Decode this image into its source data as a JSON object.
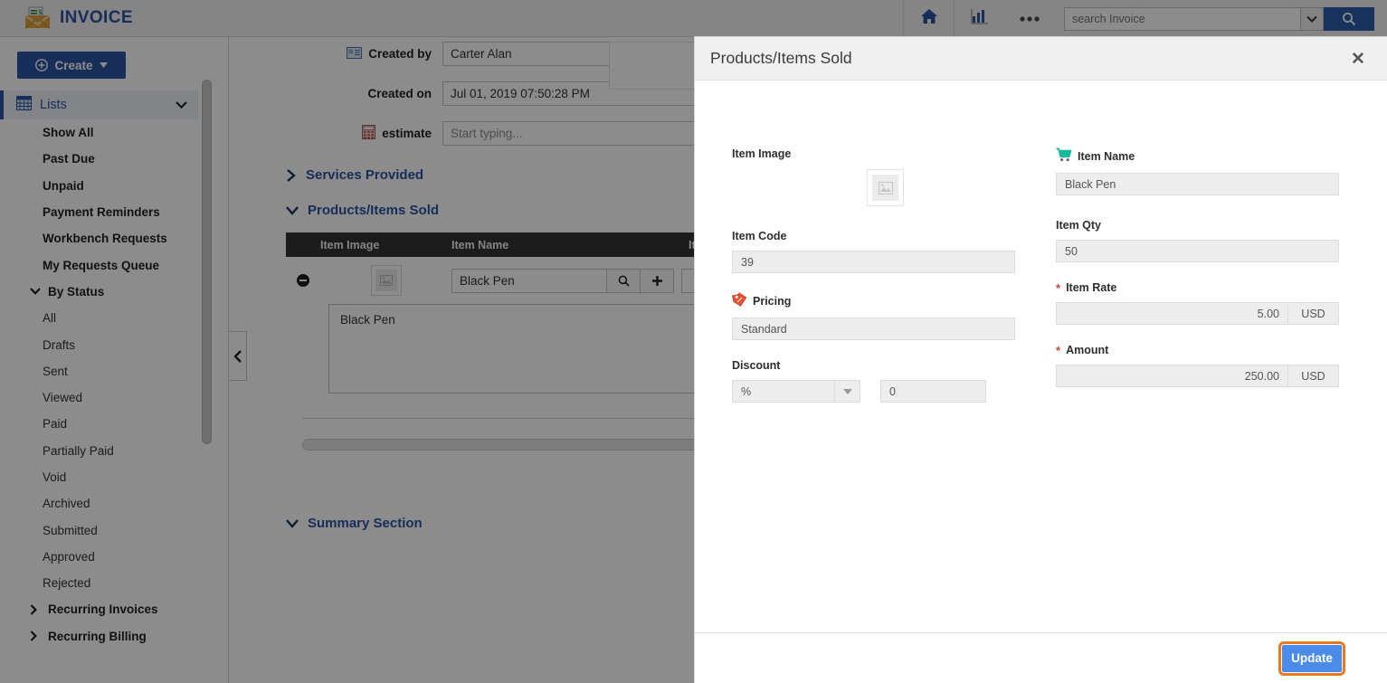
{
  "app": {
    "brand": "INVOICE",
    "logo_icon": "envelope-document-dollar-icon"
  },
  "topbar": {
    "home_icon": "home-icon",
    "reports_icon": "bar-chart-icon",
    "more_icon": "ellipsis-icon",
    "search_placeholder": "search Invoice",
    "search_value": "",
    "search_caret_icon": "chevron-down-icon",
    "search_button_icon": "search-icon"
  },
  "sidebar": {
    "create_label": "Create",
    "create_plus_icon": "plus-circle-icon",
    "create_caret_icon": "caret-down-icon",
    "lists": {
      "label": "Lists",
      "icon": "grid-calendar-icon",
      "caret_icon": "chevron-down-icon"
    },
    "items": [
      {
        "label": "Show All",
        "type": "bold"
      },
      {
        "label": "Past Due",
        "type": "bold"
      },
      {
        "label": "Unpaid",
        "type": "bold"
      },
      {
        "label": "Payment Reminders",
        "type": "bold"
      },
      {
        "label": "Workbench Requests",
        "type": "bold"
      },
      {
        "label": "My Requests Queue",
        "type": "bold"
      },
      {
        "label": "By Status",
        "type": "group",
        "icon": "chevron-down-icon",
        "expanded": true
      },
      {
        "label": "All",
        "type": "sub"
      },
      {
        "label": "Drafts",
        "type": "sub"
      },
      {
        "label": "Sent",
        "type": "sub"
      },
      {
        "label": "Viewed",
        "type": "sub"
      },
      {
        "label": "Paid",
        "type": "sub"
      },
      {
        "label": "Partially Paid",
        "type": "sub"
      },
      {
        "label": "Void",
        "type": "sub"
      },
      {
        "label": "Archived",
        "type": "sub"
      },
      {
        "label": "Submitted",
        "type": "sub"
      },
      {
        "label": "Approved",
        "type": "sub"
      },
      {
        "label": "Rejected",
        "type": "sub"
      },
      {
        "label": "Recurring Invoices",
        "type": "group",
        "icon": "chevron-right-icon",
        "expanded": false
      },
      {
        "label": "Recurring Billing",
        "type": "group",
        "icon": "chevron-right-icon",
        "expanded": false
      }
    ]
  },
  "main": {
    "collapse_icon": "chevron-left-icon",
    "fields": [
      {
        "label": "Created by",
        "icon": "contact-card-icon",
        "value": "Carter Alan",
        "placeholder": ""
      },
      {
        "label": "Created on",
        "icon": "",
        "value": "Jul 01, 2019 07:50:28 PM",
        "placeholder": ""
      },
      {
        "label": "estimate",
        "icon": "calculator-icon",
        "value": "",
        "placeholder": "Start typing..."
      }
    ],
    "sections": [
      {
        "label": "Services Provided",
        "icon": "chevron-right-icon",
        "expanded": false
      },
      {
        "label": "Products/Items Sold",
        "icon": "chevron-down-icon",
        "expanded": true
      },
      {
        "label": "Summary Section",
        "icon": "chevron-down-icon",
        "expanded": true
      }
    ],
    "table": {
      "columns": [
        "",
        "Item Image",
        "Item Name",
        "Ite"
      ],
      "row": {
        "remove_icon": "minus-circle-icon",
        "image_icon": "image-placeholder-icon",
        "item_name": "Black Pen",
        "search_icon": "search-icon",
        "add_icon": "plus-icon"
      },
      "suggestion": "Black Pen"
    }
  },
  "modal": {
    "title": "Products/Items Sold",
    "close_icon": "close-icon",
    "item_image": {
      "label": "Item Image",
      "placeholder_icon": "image-placeholder-icon"
    },
    "item_code": {
      "label": "Item Code",
      "value": "39"
    },
    "pricing": {
      "label": "Pricing",
      "icon": "price-tag-icon",
      "value": "Standard"
    },
    "discount": {
      "label": "Discount",
      "unit": "%",
      "unit_caret_icon": "caret-down-icon",
      "value": "0"
    },
    "item_name": {
      "label": "Item Name",
      "icon": "shopping-cart-icon",
      "value": "Black Pen"
    },
    "item_qty": {
      "label": "Item Qty",
      "value": "50"
    },
    "item_rate": {
      "label": "Item Rate",
      "required": "*",
      "value": "5.00",
      "currency": "USD"
    },
    "amount": {
      "label": "Amount",
      "required": "*",
      "value": "250.00",
      "currency": "USD"
    },
    "footer": {
      "update_label": "Update"
    }
  },
  "colors": {
    "brand_blue": "#2a55a3",
    "accent_blue": "#4a8ce8",
    "focus_orange": "#f07818",
    "required_red": "#e03b3b",
    "cart_teal": "#14b89a",
    "table_header_dark": "#333333"
  }
}
